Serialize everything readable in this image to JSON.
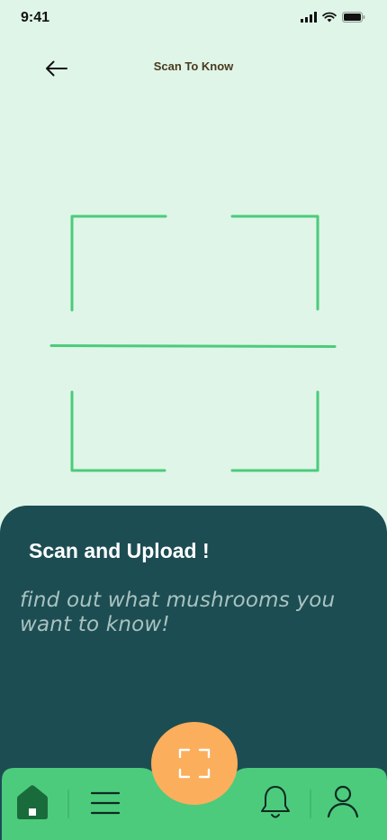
{
  "status_bar": {
    "time": "9:41"
  },
  "header": {
    "title": "Scan To Know",
    "back_icon": "arrow-left-icon"
  },
  "panel": {
    "title": "Scan and Upload !",
    "subtitle": "find out what mushrooms you want to know!"
  },
  "tabbar": {
    "items": [
      {
        "icon": "home-icon"
      },
      {
        "icon": "menu-icon"
      },
      {
        "icon": "scan-icon"
      },
      {
        "icon": "bell-icon"
      },
      {
        "icon": "user-icon"
      }
    ]
  },
  "colors": {
    "background": "#DFF5E8",
    "scan_frame": "#4CCB7C",
    "panel": "#1C4D53",
    "tabbar": "#4CCB7C",
    "fab": "#FBAE5C",
    "home_active": "#1A6B3B"
  }
}
